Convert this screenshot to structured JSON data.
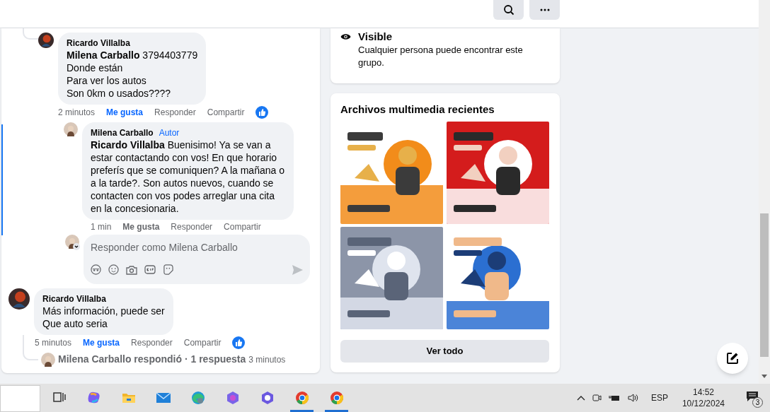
{
  "thread": [
    {
      "author": "Ricardo Villalba",
      "lines": [
        "**Milena Carballo** 3794403779",
        "Donde están",
        "Para ver los autos",
        "Son 0km o usados????"
      ],
      "time": "2 minutos",
      "like": "Me gusta",
      "reply": "Responder",
      "share": "Compartir",
      "liked": true,
      "reactions": true,
      "replies": [
        {
          "author": "Milena Carballo",
          "badge": "Autor",
          "lines": [
            "**Ricardo Villalba** Buenisimo! Ya se van a estar contactando con vos! En que horario preferís que se comuniquen? A la mañana o a la tarde?. Son autos nuevos, cuando se contacten con vos podes arreglar una cita en la concesionaria."
          ],
          "time": "1 min",
          "like": "Me gusta",
          "reply": "Responder",
          "share": "Compartir",
          "liked": false,
          "reactions": false,
          "highlighted": true
        }
      ],
      "reply_box": {
        "placeholder": "Responder como Milena Carballo"
      }
    },
    {
      "author": "Ricardo Villalba",
      "lines": [
        "Más información, puede ser",
        "Que auto seria"
      ],
      "time": "5 minutos",
      "like": "Me gusta",
      "reply": "Responder",
      "share": "Compartir",
      "liked": true,
      "reactions": true,
      "replies_summary": {
        "text": "Milena Carballo respondió · 1 respuesta",
        "time": "3 minutos"
      }
    }
  ],
  "privacy": {
    "title": "Visible",
    "text": "Cualquier persona puede encontrar este grupo."
  },
  "media": {
    "title": "Archivos multimedia recientes",
    "button": "Ver todo"
  },
  "taskbar": {
    "apps": [
      {
        "kind": "taskview",
        "running": false
      },
      {
        "kind": "copilot",
        "running": false
      },
      {
        "kind": "folder",
        "running": false
      },
      {
        "kind": "mail",
        "running": false
      },
      {
        "kind": "edge",
        "running": false
      },
      {
        "kind": "hexagon",
        "running": false
      },
      {
        "kind": "hexagon2",
        "running": false
      },
      {
        "kind": "chrome",
        "running": true
      },
      {
        "kind": "chrome",
        "running": true
      }
    ],
    "language": "ESP",
    "time": "14:52",
    "date": "10/12/2024",
    "notifications": "3"
  }
}
